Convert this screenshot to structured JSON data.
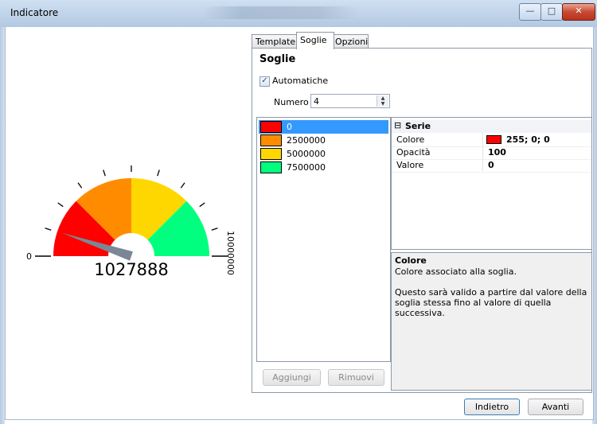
{
  "window": {
    "title": "Indicatore"
  },
  "controls": {
    "minimize": "—",
    "maximize": "□",
    "close": "✕"
  },
  "gauge": {
    "value_text": "1027888",
    "value": 1027888,
    "min_label": "0",
    "max_label": "10000000",
    "min": 0,
    "max": 10000000,
    "bands": [
      {
        "color": "#ff0000",
        "from": 0,
        "to": 2500000
      },
      {
        "color": "#ff8c00",
        "from": 2500000,
        "to": 5000000
      },
      {
        "color": "#ffd700",
        "from": 5000000,
        "to": 7500000
      },
      {
        "color": "#00ff7f",
        "from": 7500000,
        "to": 10000000
      }
    ],
    "needle_color": "#7b8794"
  },
  "tabs": [
    {
      "label": "Template"
    },
    {
      "label": "Soglie",
      "active": true
    },
    {
      "label": "Opzioni"
    }
  ],
  "soglie": {
    "heading": "Soglie",
    "automatic_label": "Automatiche",
    "automatic_checked": true,
    "number_label": "Numero",
    "number_value": "4",
    "thresholds": [
      {
        "value": "0",
        "color": "#ff0000",
        "selected": true
      },
      {
        "value": "2500000",
        "color": "#ff8c00"
      },
      {
        "value": "5000000",
        "color": "#ffd700"
      },
      {
        "value": "7500000",
        "color": "#00ff7f"
      }
    ],
    "add_button": "Aggiungi",
    "remove_button": "Rimuovi"
  },
  "properties": {
    "category": "Serie",
    "rows": [
      {
        "name": "Colore",
        "value": "255; 0; 0"
      },
      {
        "name": "Opacità",
        "value": "100"
      },
      {
        "name": "Valore",
        "value": "0"
      }
    ]
  },
  "help": {
    "title": "Colore",
    "body": "Colore associato alla soglia.\n\nQuesto sarà valido a partire dal valore della soglia stessa fino al valore di quella successiva."
  },
  "footer": {
    "back": "Indietro",
    "next": "Avanti"
  }
}
